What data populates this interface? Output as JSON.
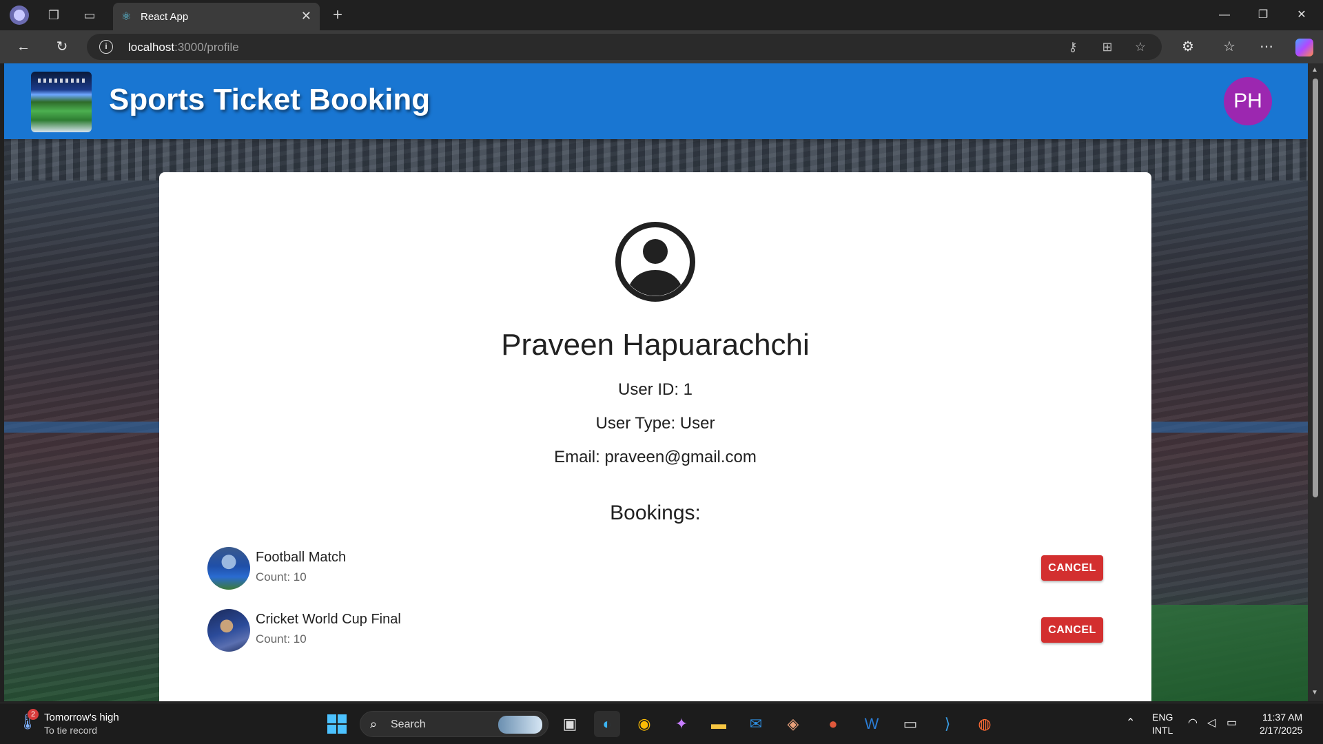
{
  "browser": {
    "tab_title": "React App",
    "url_host": "localhost",
    "url_path": ":3000/profile"
  },
  "header": {
    "title": "Sports Ticket Booking",
    "avatar_initials": "PH",
    "avatar_color": "#9c27b0",
    "brand_color": "#1976d2"
  },
  "profile": {
    "name": "Praveen Hapuarachchi",
    "user_id": "User ID: 1",
    "user_type": "User Type: User",
    "email": "Email: praveen@gmail.com",
    "bookings_title": "Bookings:",
    "bookings": [
      {
        "name": "Football Match",
        "count": "Count: 10",
        "action": "CANCEL"
      },
      {
        "name": "Cricket World Cup Final",
        "count": "Count: 10",
        "action": "CANCEL"
      }
    ],
    "cancel_color": "#d32f2f"
  },
  "taskbar": {
    "weather_title": "Tomorrow's high",
    "weather_sub": "To tie record",
    "weather_badge": "2",
    "search_label": "Search",
    "lang_top": "ENG",
    "lang_bottom": "INTL",
    "time": "11:37 AM",
    "date": "2/17/2025"
  }
}
